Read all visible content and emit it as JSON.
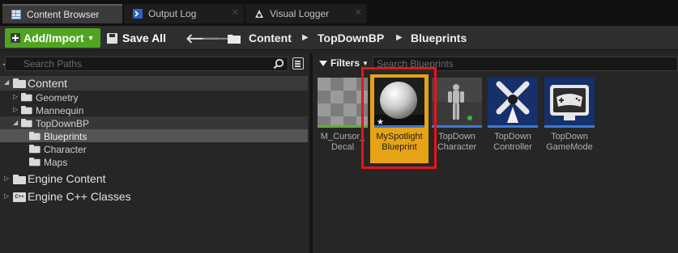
{
  "tabs": [
    {
      "label": "Content Browser",
      "icon": "content-browser-icon",
      "active": true
    },
    {
      "label": "Output Log",
      "icon": "output-log-icon",
      "active": false
    },
    {
      "label": "Visual Logger",
      "icon": "visual-logger-icon",
      "active": false
    }
  ],
  "toolbar": {
    "add_import_label": "Add/Import",
    "save_all_label": "Save All",
    "breadcrumb": [
      "Content",
      "TopDownBP",
      "Blueprints"
    ]
  },
  "left_panel": {
    "search_placeholder": "Search Paths",
    "tree": [
      {
        "label": "Content"
      },
      {
        "label": "Geometry"
      },
      {
        "label": "Mannequin"
      },
      {
        "label": "TopDownBP"
      },
      {
        "label": "Blueprints"
      },
      {
        "label": "Character"
      },
      {
        "label": "Maps"
      },
      {
        "label": "Engine Content"
      },
      {
        "label": "Engine C++ Classes"
      }
    ]
  },
  "right_panel": {
    "filters_label": "Filters",
    "search_placeholder": "Search Blueprints",
    "assets": [
      {
        "label_line1": "M_Cursor_",
        "label_line2": "Decal",
        "color": "#5fae3a"
      },
      {
        "label_line1": "MySpotlight",
        "label_line2": "Blueprint",
        "color": "#3d7ad1"
      },
      {
        "label_line1": "TopDown",
        "label_line2": "Character",
        "color": "#3d7ad1"
      },
      {
        "label_line1": "TopDown",
        "label_line2": "Controller",
        "color": "#3d7ad1"
      },
      {
        "label_line1": "TopDown",
        "label_line2": "GameMode",
        "color": "#3d7ad1"
      }
    ]
  },
  "colors": {
    "add_button": "#50a520",
    "selection": "#e6a316",
    "highlight_box": "#e5151c"
  }
}
